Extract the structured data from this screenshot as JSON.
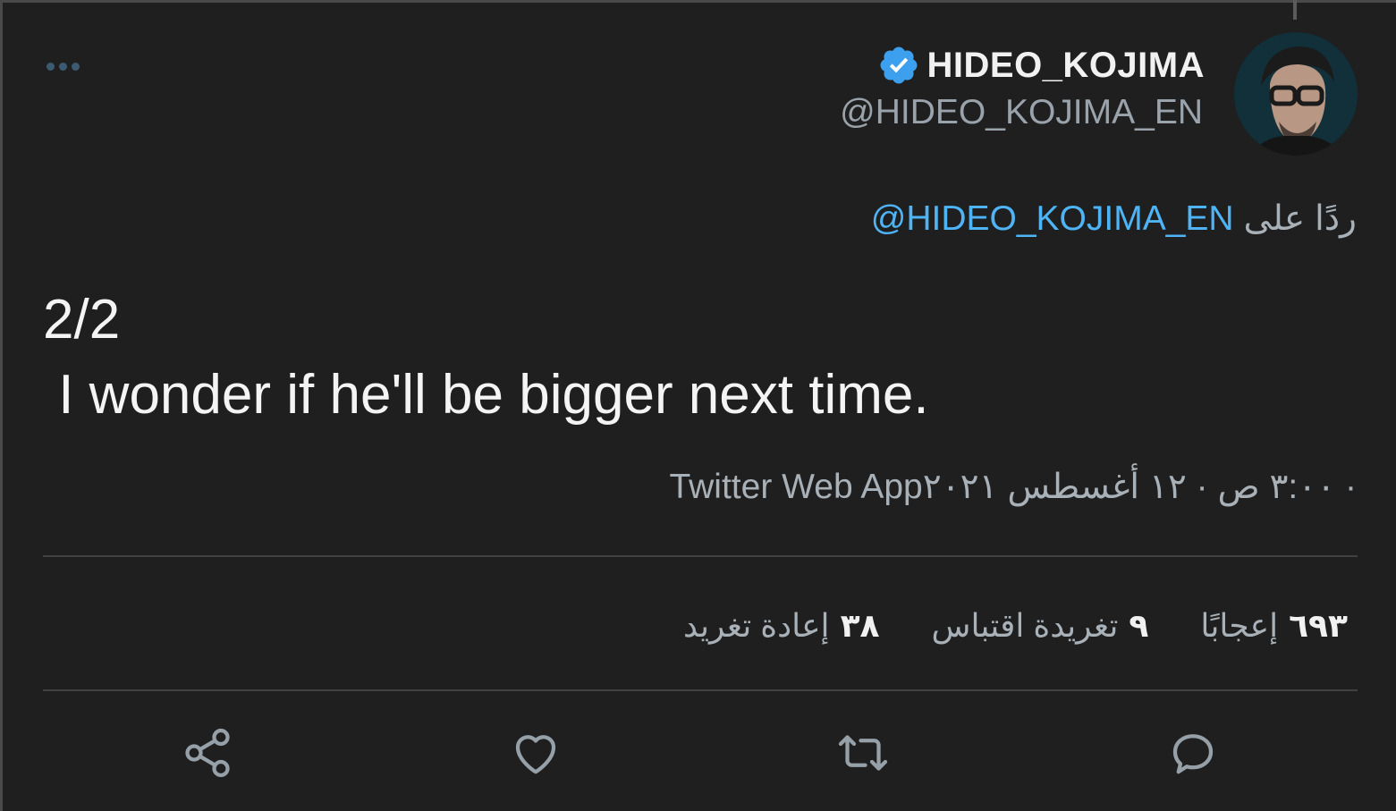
{
  "tweet": {
    "display_name": "HIDEO_KOJIMA",
    "handle": "@HIDEO_KOJIMA_EN",
    "reply_prefix": "ردًا على",
    "reply_to": "@HIDEO_KOJIMA_EN",
    "text_line1": "2/2",
    "text_line2": " I wonder if he'll be bigger next time.",
    "timestamp": "٣:٠٠ ص · ١٢ أغسطس ٢٠٢١ · ",
    "source": "Twitter Web App"
  },
  "stats": {
    "retweets": {
      "count": "٣٨",
      "label": "إعادة تغريد"
    },
    "quotes": {
      "count": "٩",
      "label": "تغريدة اقتباس"
    },
    "likes": {
      "count": "٦٩٣",
      "label": "إعجابًا"
    }
  },
  "icons": {
    "more": "more-horizontal-icon",
    "verified": "verified-badge-icon",
    "share": "share-icon",
    "like": "heart-icon",
    "retweet": "retweet-icon",
    "reply": "reply-icon"
  },
  "colors": {
    "background": "#1f1f1f",
    "accent": "#4eb4f5",
    "verified": "#3da0ee",
    "secondary_text": "#a9b1b8",
    "icon": "#96a0a8"
  }
}
